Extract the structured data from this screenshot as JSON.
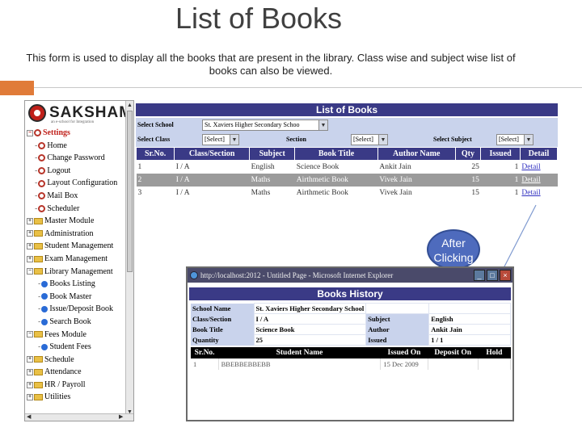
{
  "slide": {
    "title": "List of Books",
    "description": "This form is used to display all the books that are present in the library. Class wise and subject wise list of books can also be viewed."
  },
  "logo": {
    "text": "SAKSHAM",
    "subtitle": "an e-school for Integration"
  },
  "sidebar": {
    "items": [
      {
        "label": "Settings",
        "type": "root-open"
      },
      {
        "label": "Home",
        "type": "child"
      },
      {
        "label": "Change Password",
        "type": "child"
      },
      {
        "label": "Logout",
        "type": "child"
      },
      {
        "label": "Layout Configuration",
        "type": "child"
      },
      {
        "label": "Mail Box",
        "type": "child"
      },
      {
        "label": "Scheduler",
        "type": "child"
      },
      {
        "label": "Master Module",
        "type": "folder"
      },
      {
        "label": "Administration",
        "type": "folder"
      },
      {
        "label": "Student Management",
        "type": "folder"
      },
      {
        "label": "Exam Management",
        "type": "folder"
      },
      {
        "label": "Library Management",
        "type": "folder-open"
      },
      {
        "label": "Books Listing",
        "type": "leaf"
      },
      {
        "label": "Book Master",
        "type": "leaf"
      },
      {
        "label": "Issue/Deposit Book",
        "type": "leaf"
      },
      {
        "label": "Search Book",
        "type": "leaf"
      },
      {
        "label": "Fees Module",
        "type": "folder-open"
      },
      {
        "label": "Student Fees",
        "type": "leaf"
      },
      {
        "label": "Schedule",
        "type": "folder"
      },
      {
        "label": "Attendance",
        "type": "folder"
      },
      {
        "label": "HR / Payroll",
        "type": "folder"
      },
      {
        "label": "Utilities",
        "type": "folder"
      }
    ]
  },
  "main": {
    "title": "List of Books",
    "filters": {
      "school_label": "Select School",
      "school_value": "St. Xaviers Higher Secondary Schoo",
      "class_label": "Select Class",
      "class_value": "[Select]",
      "section_label": "Section",
      "section_value": "[Select]",
      "subject_label": "Select Subject",
      "subject_value": "[Select]"
    },
    "columns": [
      "Sr.No.",
      "Class/Section",
      "Subject",
      "Book Title",
      "Author Name",
      "Qty",
      "Issued",
      "Detail"
    ],
    "rows": [
      [
        "1",
        "I / A",
        "English",
        "Science Book",
        "Ankit Jain",
        "25",
        "1",
        "Detail"
      ],
      [
        "2",
        "I / A",
        "Maths",
        "Airthmetic Book",
        "Vivek Jain",
        "15",
        "1",
        "Detail"
      ],
      [
        "3",
        "I / A",
        "Maths",
        "Airthmetic Book",
        "Vivek Jain",
        "15",
        "1",
        "Detail"
      ]
    ]
  },
  "callout": {
    "text": "After Clicking"
  },
  "popup": {
    "window_title": "http://localhost:2012 - Untitled Page - Microsoft Internet Explorer",
    "title": "Books History",
    "info": [
      {
        "k1": "School Name",
        "v1": "St. Xaviers Higher Secondary School",
        "k2": "",
        "v2": ""
      },
      {
        "k1": "Class/Section",
        "v1": "I / A",
        "k2": "Subject",
        "v2": "English"
      },
      {
        "k1": "Book Title",
        "v1": "Science Book",
        "k2": "Author",
        "v2": "Ankit Jain"
      },
      {
        "k1": "Quantity",
        "v1": "25",
        "k2": "Issued",
        "v2": "1 / 1"
      }
    ],
    "columns": [
      "Sr.No.",
      "Student Name",
      "Issued On",
      "Deposit On",
      "Hold"
    ],
    "rows": [
      [
        "1",
        "BBEBBEBBEBB",
        "15 Dec 2009",
        "",
        ""
      ]
    ]
  },
  "colors": {
    "header_blue": "#3a3a86",
    "filter_bg": "#c9d3ec",
    "accent_orange": "#e07b39",
    "callout_blue": "#4e6bbd"
  }
}
